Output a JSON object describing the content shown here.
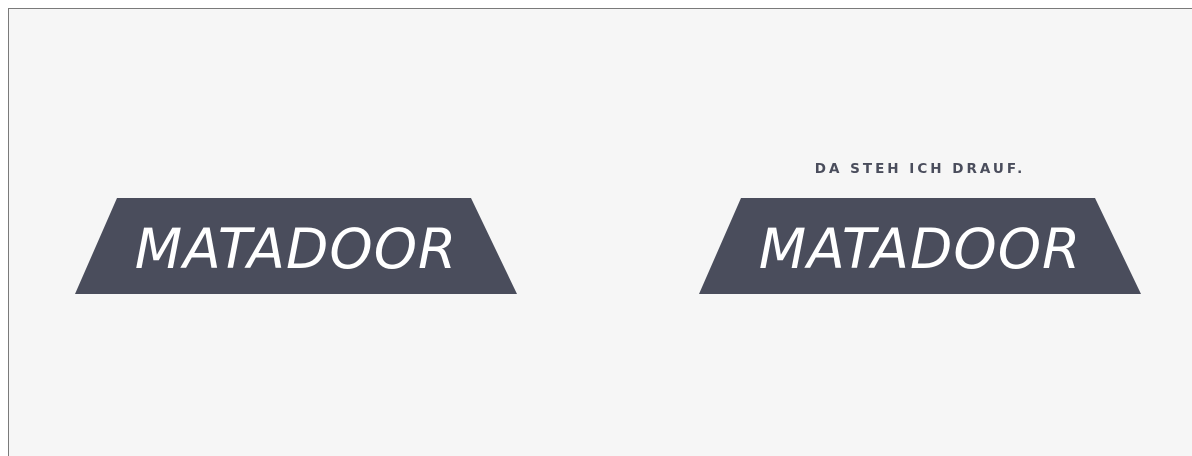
{
  "brand": {
    "name": "MATADOOR",
    "tagline": "DA STEH ICH DRAUF.",
    "colors": {
      "background": "#f6f6f6",
      "plate": "#4a4d5c",
      "lettering": "#ffffff"
    }
  },
  "logos": [
    {
      "variant": "wordmark",
      "text": "MATADOOR"
    },
    {
      "variant": "wordmark-with-tagline",
      "text": "MATADOOR",
      "tagline": "DA STEH ICH DRAUF."
    }
  ]
}
